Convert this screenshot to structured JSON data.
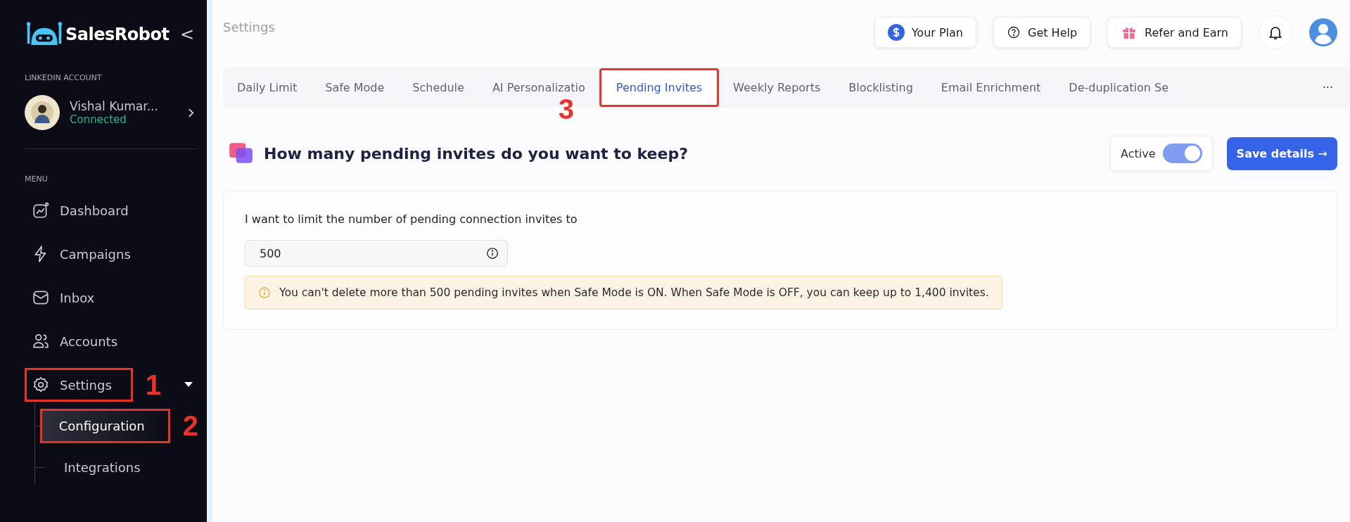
{
  "sidebar": {
    "logo": "SalesRobot",
    "collapse": "<",
    "account_heading": "LINKEDIN ACCOUNT",
    "account": {
      "name": "Vishal Kumar...",
      "status": "Connected"
    },
    "menu_heading": "MENU",
    "items": [
      {
        "label": "Dashboard",
        "selected": false
      },
      {
        "label": "Campaigns",
        "selected": false
      },
      {
        "label": "Inbox",
        "selected": false
      },
      {
        "label": "Accounts",
        "selected": false
      },
      {
        "label": "Settings",
        "selected": false,
        "expanded": true,
        "callout": "1",
        "children": [
          {
            "label": "Configuration",
            "selected": true,
            "callout": "2"
          },
          {
            "label": "Integrations",
            "selected": false
          }
        ]
      }
    ]
  },
  "header": {
    "title": "Settings",
    "buttons": [
      {
        "label": "Your Plan"
      },
      {
        "label": "Get Help"
      },
      {
        "label": "Refer and Earn"
      }
    ]
  },
  "tabs": [
    {
      "label": "Daily Limit",
      "selected": false
    },
    {
      "label": "Safe Mode",
      "selected": false
    },
    {
      "label": "Schedule",
      "selected": false
    },
    {
      "label": "AI Personalizatio",
      "selected": false
    },
    {
      "label": "Pending Invites",
      "selected": true,
      "callout": "3"
    },
    {
      "label": "Weekly Reports",
      "selected": false
    },
    {
      "label": "Blocklisting",
      "selected": false
    },
    {
      "label": "Email Enrichment",
      "selected": false
    },
    {
      "label": "De-duplication Se",
      "selected": false
    }
  ],
  "tabs_more": "···",
  "section": {
    "title": "How many pending invites do you want to keep?",
    "toggle": {
      "label": "Active",
      "on": true
    },
    "save": "Save details",
    "save_arrow": "→",
    "field_label": "I want to limit the number of pending connection invites to",
    "value": "500",
    "notice": "You can't delete more than 500 pending invites when Safe Mode is ON. When Safe Mode is OFF, you can keep up to 1,400 invites."
  }
}
